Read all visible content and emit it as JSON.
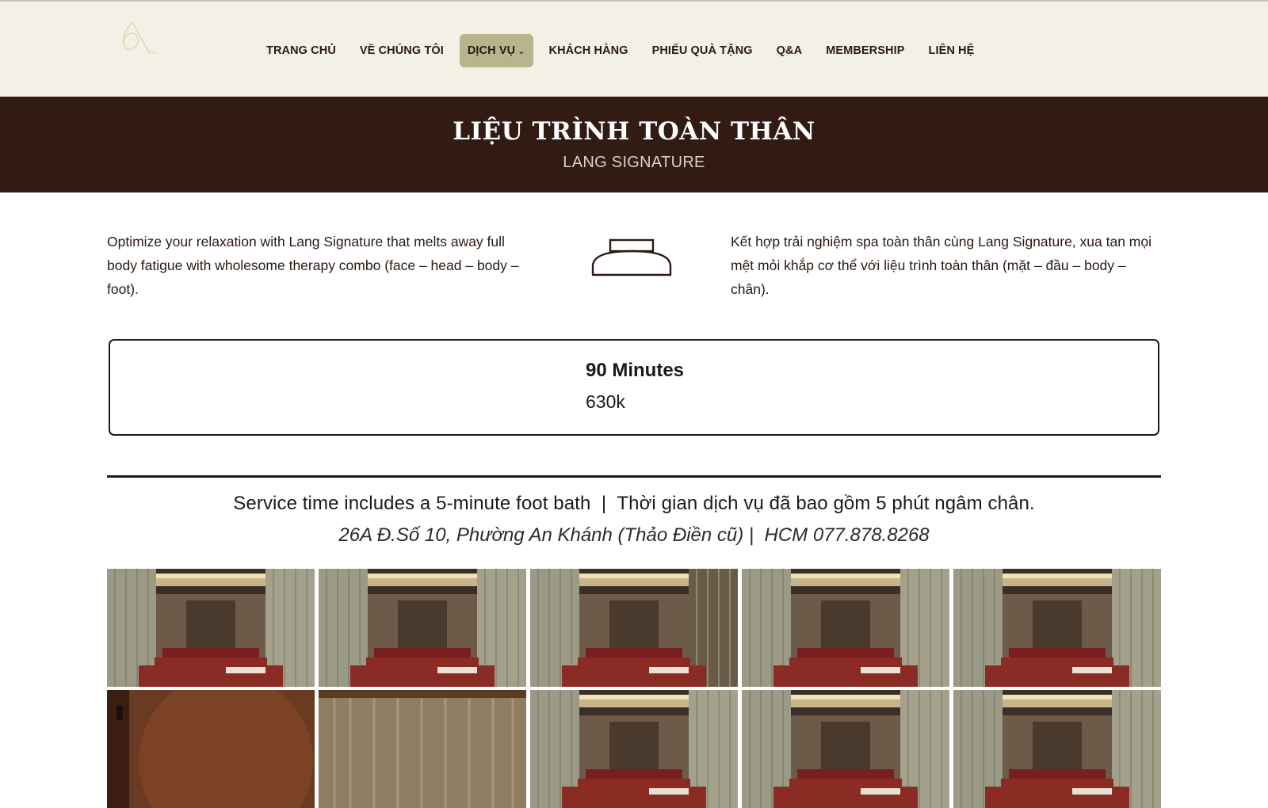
{
  "header": {
    "nav": [
      {
        "label": "TRANG CHỦ"
      },
      {
        "label": "VỀ CHÚNG TÔI"
      },
      {
        "label": "DỊCH VỤ",
        "active": true
      },
      {
        "label": "KHÁCH HÀNG"
      },
      {
        "label": "PHIẾU QUÀ TẶNG"
      },
      {
        "label": "Q&A"
      },
      {
        "label": "MEMBERSHIP"
      },
      {
        "label": "LIÊN HỆ"
      }
    ],
    "dropdown_icon": "chevron-down-icon"
  },
  "banner": {
    "title": "LIỆU TRÌNH TOÀN THÂN",
    "subtitle": "LANG SIGNATURE"
  },
  "description": {
    "english": "Optimize your relaxation with Lang Signature that melts away full body fatigue with wholesome therapy combo (face – head – body – foot).",
    "vietnamese": "Kết hợp trải nghiệm spa toàn thân cùng Lang Signature, xua tan mọi mệt mỏi khắp cơ thể với liệu trình toàn thân (mặt – đầu – body – chân).",
    "center_icon": "bowl-icon"
  },
  "pricing": {
    "duration": "90 Minutes",
    "price": "630k"
  },
  "footer_note": {
    "service_note": "Service time includes a 5-minute foot bath  |  Thời gian dịch vụ đã bao gồm 5 phút ngâm chân.",
    "address": "26A Đ.Số 10, Phường An Khánh (Thảo Điền cũ) |  HCM 077.878.8268"
  },
  "gallery": {
    "photos": [
      "spa-room",
      "spa-room",
      "spa-room",
      "spa-room",
      "spa-room",
      "spa-interior",
      "spa-curtain",
      "spa-room",
      "spa-room",
      "spa-room"
    ]
  },
  "colors": {
    "header_bg": "#f3f0e6",
    "banner_bg": "#311b13",
    "active_nav_bg": "#b8b48e",
    "text": "#2b1a12"
  }
}
